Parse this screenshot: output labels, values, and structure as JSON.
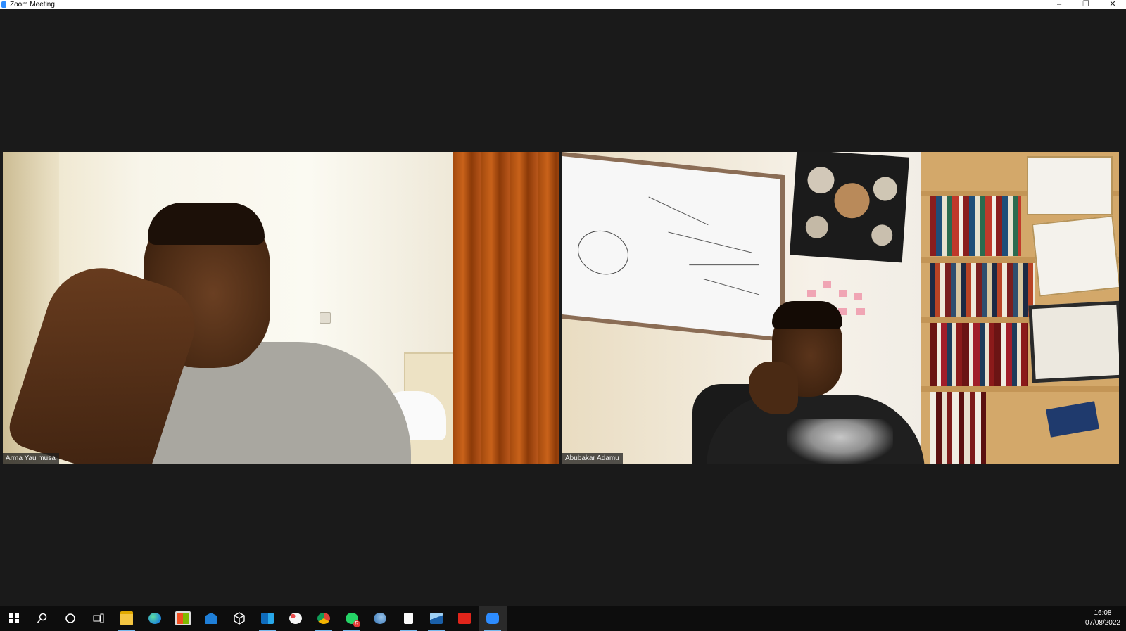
{
  "window": {
    "title": "Zoom Meeting",
    "controls": {
      "minimize": "–",
      "restore": "❐",
      "close": "✕"
    }
  },
  "participants": [
    {
      "name": "Arma Yau musa"
    },
    {
      "name": "Abubakar Adamu"
    }
  ],
  "taskbar": {
    "items": [
      {
        "icon": "windows-start-icon",
        "color": "#ffffff"
      },
      {
        "icon": "search-icon",
        "color": "#ffffff"
      },
      {
        "icon": "cortana-icon",
        "color": "#ffffff"
      },
      {
        "icon": "task-view-icon",
        "color": "#ffffff"
      },
      {
        "icon": "file-explorer-icon",
        "color": "#f4c542"
      },
      {
        "icon": "edge-icon",
        "color": "#2fb5e8"
      },
      {
        "icon": "store-icon",
        "color": "#ffffff"
      },
      {
        "icon": "mail-icon",
        "color": "#1f7fd8"
      },
      {
        "icon": "unity-icon",
        "color": "#ffffff"
      },
      {
        "icon": "outlook-icon",
        "color": "#0f6cbd"
      },
      {
        "icon": "paint-icon",
        "color": "#e8e8e8"
      },
      {
        "icon": "chrome-icon",
        "color": "#4caf50"
      },
      {
        "icon": "whatsapp-icon",
        "color": "#25d366",
        "badge": "5"
      },
      {
        "icon": "browser-icon",
        "color": "#3f8ad0"
      },
      {
        "icon": "notepad-icon",
        "color": "#ffffff"
      },
      {
        "icon": "photos-icon",
        "color": "#3c8fd6"
      },
      {
        "icon": "acrobat-icon",
        "color": "#e1251b"
      },
      {
        "icon": "zoom-icon",
        "color": "#2d8cff"
      }
    ],
    "clock": {
      "time": "16:08",
      "date": "07/08/2022"
    }
  }
}
